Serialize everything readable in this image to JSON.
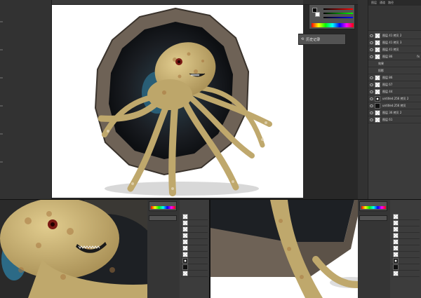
{
  "ui": {
    "history_panel_label": "历史记录",
    "layers_tab": "图层",
    "channels_tab": "通道",
    "paths_tab": "路径",
    "effects_label": "效果",
    "projection_label": "投影",
    "fx_badge": "fx"
  },
  "layers": [
    {
      "name": "图层 41 拷贝 2",
      "thumb": "checker"
    },
    {
      "name": "图层 41 拷贝 3",
      "thumb": "checker"
    },
    {
      "name": "图层 41 拷贝",
      "thumb": "checker"
    },
    {
      "name": "图层 86",
      "thumb": "checker",
      "fx": true
    },
    {
      "name": "图层 86",
      "thumb": "checker"
    },
    {
      "name": "图层 67",
      "thumb": "checker"
    },
    {
      "name": "图层 44",
      "thumb": "checker"
    },
    {
      "name": "untitled.256 拷贝 2",
      "thumb": "circle"
    },
    {
      "name": "untitled.256 拷贝",
      "thumb": "dark"
    },
    {
      "name": "图层 36 拷贝 2",
      "thumb": "checker"
    },
    {
      "name": "图层 61",
      "thumb": "checker"
    }
  ],
  "colors": {
    "ps_dark": "#282828",
    "ps_panel": "#3c3c3c",
    "octopus_skin": "#c8b476",
    "octopus_spots": "#a6733d",
    "stone": "#6e6256",
    "water": "#2c6a86"
  }
}
